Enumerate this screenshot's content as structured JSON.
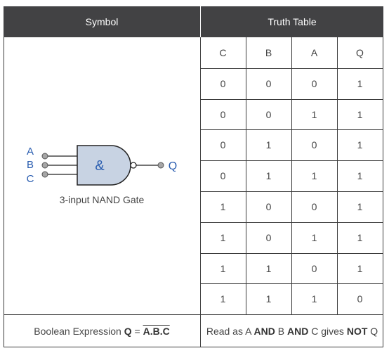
{
  "header": {
    "symbol_title": "Symbol",
    "truth_table_title": "Truth Table"
  },
  "symbol": {
    "inputs": [
      "A",
      "B",
      "C"
    ],
    "output": "Q",
    "gate_glyph": "&",
    "caption": "3-input NAND Gate",
    "colors": {
      "label": "#2a5db0",
      "gate_fill": "#c8d3e3",
      "terminal_fill": "#a6a6a6",
      "stroke": "#222222"
    }
  },
  "truth_table": {
    "columns": [
      "C",
      "B",
      "A",
      "Q"
    ],
    "rows": [
      [
        "0",
        "0",
        "0",
        "1"
      ],
      [
        "0",
        "0",
        "1",
        "1"
      ],
      [
        "0",
        "1",
        "0",
        "1"
      ],
      [
        "0",
        "1",
        "1",
        "1"
      ],
      [
        "1",
        "0",
        "0",
        "1"
      ],
      [
        "1",
        "0",
        "1",
        "1"
      ],
      [
        "1",
        "1",
        "0",
        "1"
      ],
      [
        "1",
        "1",
        "1",
        "0"
      ]
    ]
  },
  "footer": {
    "expression_prefix": "Boolean Expression ",
    "expression_output": "Q",
    "expression_equals": " = ",
    "expression_body": "A.B.C",
    "read_as": {
      "p1": "Read as A ",
      "and1": "AND",
      "p2": " B ",
      "and2": "AND",
      "p3": " C gives ",
      "not": "NOT",
      "p4": " Q"
    }
  },
  "colors": {
    "header_bg": "#424244",
    "header_text": "#ffffff",
    "border": "#3c3c3c"
  }
}
